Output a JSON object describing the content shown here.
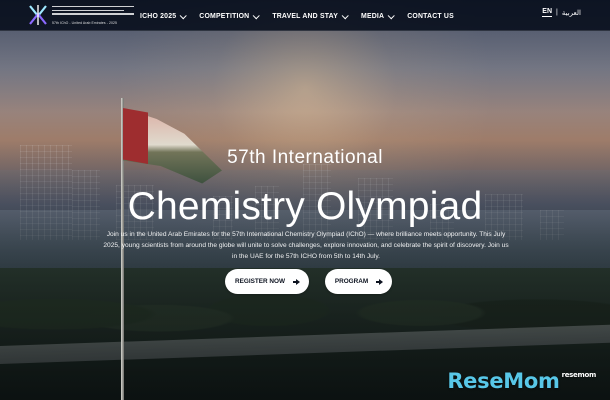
{
  "site": {
    "logo": {
      "name": "57th IChO logo",
      "caption": "57th IChO - United Arab Emirates - 2025"
    },
    "nav": [
      {
        "label": "ICHO 2025",
        "icon": "chevron-down-icon"
      },
      {
        "label": "COMPETITION",
        "icon": "chevron-down-icon"
      },
      {
        "label": "TRAVEL AND STAY",
        "icon": "chevron-down-icon"
      },
      {
        "label": "MEDIA",
        "icon": "chevron-down-icon"
      },
      {
        "label": "CONTACT US"
      }
    ],
    "language": {
      "active": "EN",
      "separator": "|",
      "other": "العربية"
    }
  },
  "hero": {
    "subtitle": "57th International",
    "title": "Chemistry Olympiad",
    "description": "Join us in the United Arab Emirates for the 57th International Chemistry Olympiad (IChO) — where brilliance meets opportunity. This July 2025, young scientists from around the globe will unite to solve challenges, explore innovation, and celebrate the spirit of discovery. Join us in the UAE for the 57th ICHO from 5th to 14th July.",
    "buttons": [
      {
        "label": "REGISTER NOW",
        "icon": "arrow-right-icon"
      },
      {
        "label": "PROGRAM",
        "icon": "arrow-right-icon"
      }
    ]
  },
  "watermark": {
    "text": "ReseMom",
    "small": "resemom"
  },
  "colors": {
    "topbar": "#060c1a",
    "button": "#ffffff",
    "button_text": "#0d1320",
    "watermark": "#58c7e8"
  }
}
